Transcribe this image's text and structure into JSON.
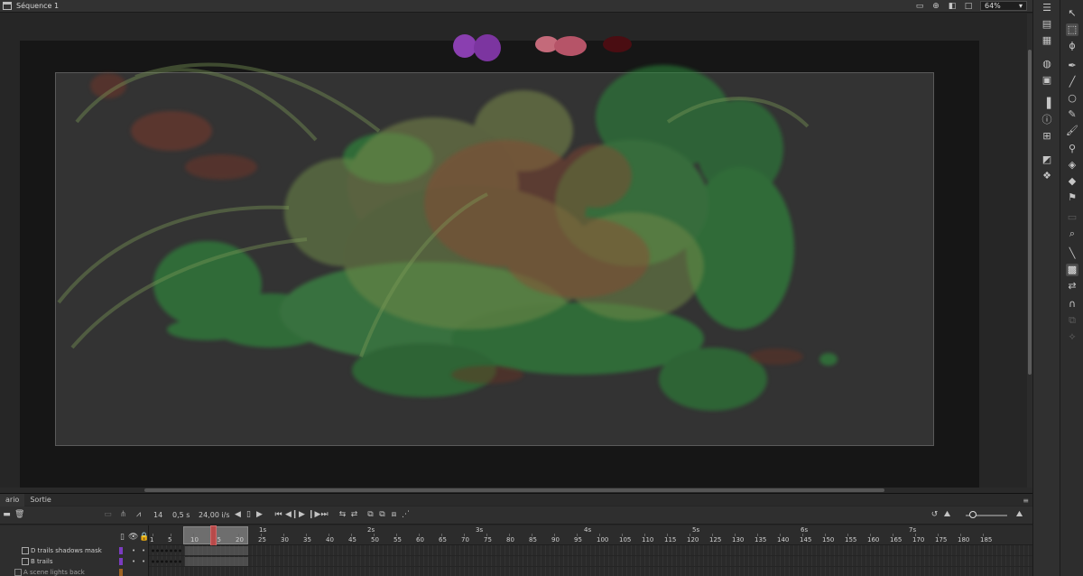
{
  "scene": {
    "title": "Séquence 1",
    "zoom": "64%"
  },
  "colors": {
    "playhead": "#b84a4a",
    "swatch_purple": "#8a3fb0",
    "swatch_pink": "#c4607a",
    "swatch_darkred": "#5a0f14",
    "layer_purple": "#7b3cc0",
    "layer_orange": "#d07a20"
  },
  "timeline": {
    "tabs": [
      "ario",
      "Sortie"
    ],
    "frame": "14",
    "time": "0,5 s",
    "fps": "24,00 i/s",
    "seconds": [
      "1s",
      "2s",
      "3s",
      "4s",
      "5s",
      "6s",
      "7s"
    ],
    "frame_numbers": [
      "1",
      "5",
      "10",
      "15",
      "20",
      "25",
      "30",
      "35",
      "40",
      "45",
      "50",
      "55",
      "60",
      "65",
      "70",
      "75",
      "80",
      "85",
      "90",
      "95",
      "100",
      "105",
      "110",
      "115",
      "120",
      "125",
      "130",
      "135",
      "140",
      "145",
      "150",
      "155",
      "160",
      "165",
      "170",
      "175",
      "180",
      "185"
    ],
    "layers": [
      {
        "name": "D trails shadows mask"
      },
      {
        "name": "B trails"
      },
      {
        "name": "A scene lights back"
      }
    ]
  }
}
